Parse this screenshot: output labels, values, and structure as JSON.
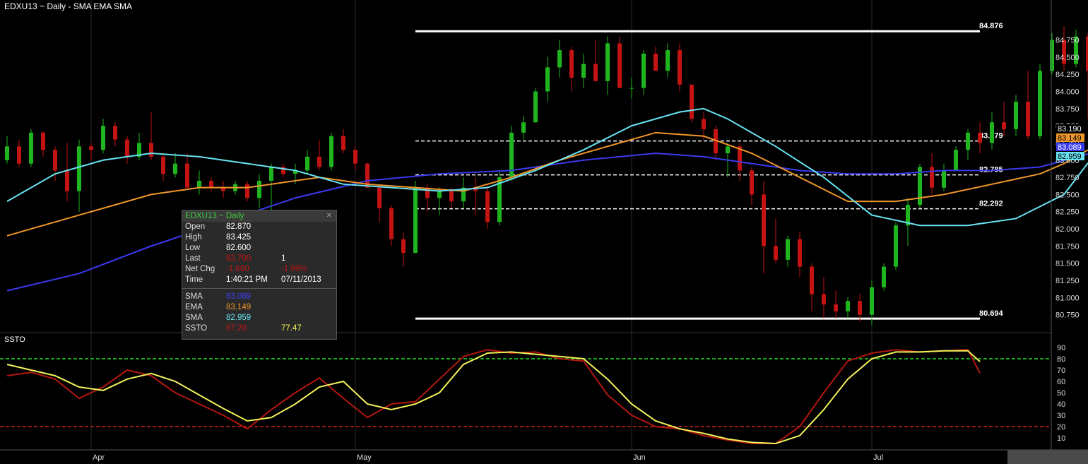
{
  "title": "EDXU13 ~ Daily  -  SMA EMA SMA",
  "ssto_label": "SSTO",
  "colors": {
    "up": "#1fb51f",
    "down": "#c41313",
    "sma_long": "#3a3aef",
    "ema": "#f0962a",
    "sma_short": "#67e3f2",
    "ssto_k": "#b3170f",
    "ssto_d": "#f3f35a",
    "ob": "#24d82c",
    "os": "#d5241f"
  },
  "data_window": {
    "header": "EDXU13 ~ Daily",
    "rows": [
      {
        "label": "Open",
        "v1": "82.870",
        "v2": ""
      },
      {
        "label": "High",
        "v1": "83.425",
        "v2": ""
      },
      {
        "label": "Low",
        "v1": "82.600",
        "v2": ""
      },
      {
        "label": "Last",
        "v1": "82.700",
        "v2": "1"
      },
      {
        "label": "Net Chg",
        "v1": "-1.660",
        "v2": "-1.99%"
      },
      {
        "label": "Time",
        "v1": "1:40:21 PM",
        "v2": "07/11/2013"
      }
    ],
    "ind_rows": [
      {
        "label": "SMA",
        "v1": "83.089",
        "v2": ""
      },
      {
        "label": "EMA",
        "v1": "83.149",
        "v2": ""
      },
      {
        "label": "SMA",
        "v1": "82.959",
        "v2": ""
      },
      {
        "label": "SSTO",
        "v1": "67.20",
        "v2": "77.47"
      }
    ]
  },
  "chart_data": {
    "type": "candlestick",
    "price_axis": {
      "ylim": [
        80.5,
        85.125
      ],
      "ticks": [
        "84.750",
        "84.500",
        "84.250",
        "84.000",
        "83.750",
        "83.500",
        "83.250",
        "83.000",
        "82.750",
        "82.500",
        "82.250",
        "82.000",
        "81.750",
        "81.500",
        "81.250",
        "81.000",
        "80.750"
      ]
    },
    "price_tick_values": [
      84.75,
      84.5,
      84.25,
      84.0,
      83.75,
      83.5,
      83.25,
      83.0,
      82.75,
      82.5,
      82.25,
      82.0,
      81.75,
      81.5,
      81.25,
      81.0,
      80.75
    ],
    "x_labels": [
      {
        "label": "Apr",
        "i": 7
      },
      {
        "label": "May",
        "i": 29
      },
      {
        "label": "Jun",
        "i": 52
      },
      {
        "label": "Jul",
        "i": 72
      }
    ],
    "candles": [
      [
        83.0,
        83.35,
        82.95,
        83.2
      ],
      [
        83.2,
        83.3,
        82.9,
        82.95
      ],
      [
        82.95,
        83.45,
        82.9,
        83.4
      ],
      [
        83.4,
        83.42,
        83.05,
        83.15
      ],
      [
        83.15,
        83.2,
        82.7,
        82.85
      ],
      [
        82.85,
        83.25,
        82.4,
        82.55
      ],
      [
        82.55,
        83.3,
        82.25,
        83.2
      ],
      [
        83.2,
        83.25,
        83.0,
        83.15
      ],
      [
        83.15,
        83.6,
        83.1,
        83.5
      ],
      [
        83.5,
        83.55,
        83.2,
        83.3
      ],
      [
        83.3,
        83.35,
        82.95,
        83.05
      ],
      [
        83.05,
        83.4,
        83.0,
        83.25
      ],
      [
        83.25,
        83.7,
        83.0,
        83.05
      ],
      [
        83.05,
        83.1,
        82.7,
        82.8
      ],
      [
        82.8,
        83.1,
        82.75,
        82.95
      ],
      [
        82.95,
        83.1,
        82.6,
        82.6
      ],
      [
        82.6,
        82.85,
        82.5,
        82.7
      ],
      [
        82.7,
        82.75,
        82.55,
        82.6
      ],
      [
        82.6,
        82.7,
        82.45,
        82.55
      ],
      [
        82.55,
        82.7,
        82.5,
        82.65
      ],
      [
        82.65,
        82.7,
        82.4,
        82.45
      ],
      [
        82.45,
        82.8,
        82.3,
        82.7
      ],
      [
        82.7,
        82.95,
        82.25,
        82.9
      ],
      [
        82.9,
        82.95,
        82.75,
        82.8
      ],
      [
        82.8,
        82.95,
        82.65,
        82.85
      ],
      [
        82.85,
        83.15,
        82.8,
        83.05
      ],
      [
        83.05,
        83.3,
        82.85,
        82.9
      ],
      [
        82.9,
        83.4,
        82.85,
        83.35
      ],
      [
        83.35,
        83.45,
        83.1,
        83.15
      ],
      [
        83.15,
        83.2,
        82.85,
        82.95
      ],
      [
        82.95,
        82.96,
        82.6,
        82.6
      ],
      [
        82.6,
        82.65,
        82.1,
        82.3
      ],
      [
        82.3,
        82.35,
        81.75,
        81.85
      ],
      [
        81.85,
        81.95,
        81.45,
        81.65
      ],
      [
        81.65,
        82.7,
        81.75,
        82.6
      ],
      [
        82.6,
        82.65,
        82.25,
        82.45
      ],
      [
        82.45,
        82.6,
        82.2,
        82.55
      ],
      [
        82.55,
        82.6,
        82.3,
        82.4
      ],
      [
        82.4,
        82.75,
        82.3,
        82.6
      ],
      [
        82.6,
        82.75,
        82.2,
        82.55
      ],
      [
        82.55,
        82.65,
        82.0,
        82.1
      ],
      [
        82.1,
        82.85,
        82.05,
        82.75
      ],
      [
        82.75,
        83.5,
        82.7,
        83.4
      ],
      [
        83.4,
        83.65,
        83.3,
        83.55
      ],
      [
        83.55,
        84.05,
        83.55,
        84.0
      ],
      [
        84.0,
        84.5,
        83.85,
        84.35
      ],
      [
        84.35,
        84.75,
        84.2,
        84.6
      ],
      [
        84.6,
        84.65,
        84.0,
        84.2
      ],
      [
        84.2,
        84.55,
        84.05,
        84.4
      ],
      [
        84.4,
        84.75,
        84.15,
        84.15
      ],
      [
        84.15,
        84.8,
        83.95,
        84.7
      ],
      [
        84.7,
        84.8,
        84.05,
        84.05
      ],
      [
        84.05,
        84.2,
        83.9,
        84.05
      ],
      [
        84.05,
        84.6,
        83.95,
        84.55
      ],
      [
        84.55,
        84.65,
        84.3,
        84.3
      ],
      [
        84.3,
        84.7,
        84.2,
        84.6
      ],
      [
        84.6,
        84.7,
        84.0,
        84.1
      ],
      [
        84.1,
        84.0,
        83.55,
        83.6
      ],
      [
        83.6,
        83.7,
        83.3,
        83.45
      ],
      [
        83.45,
        83.5,
        83.0,
        83.1
      ],
      [
        83.1,
        83.25,
        82.75,
        83.2
      ],
      [
        83.2,
        83.25,
        82.7,
        82.85
      ],
      [
        82.85,
        82.9,
        82.35,
        82.5
      ],
      [
        82.5,
        82.7,
        81.35,
        81.75
      ],
      [
        81.75,
        82.15,
        81.5,
        81.55
      ],
      [
        81.55,
        81.9,
        81.45,
        81.85
      ],
      [
        81.85,
        81.95,
        81.3,
        81.45
      ],
      [
        81.45,
        81.5,
        80.8,
        81.05
      ],
      [
        81.05,
        81.3,
        80.7,
        80.9
      ],
      [
        80.9,
        81.1,
        80.7,
        80.8
      ],
      [
        80.8,
        81.0,
        80.7,
        80.95
      ],
      [
        80.95,
        81.05,
        80.65,
        80.75
      ],
      [
        80.75,
        81.25,
        80.6,
        81.15
      ],
      [
        81.15,
        81.5,
        81.1,
        81.45
      ],
      [
        81.45,
        82.1,
        81.4,
        82.05
      ],
      [
        82.05,
        82.45,
        81.75,
        82.35
      ],
      [
        82.35,
        82.95,
        82.3,
        82.9
      ],
      [
        82.9,
        83.1,
        82.5,
        82.6
      ],
      [
        82.6,
        82.95,
        82.55,
        82.85
      ],
      [
        82.85,
        83.2,
        82.85,
        83.15
      ],
      [
        83.15,
        83.45,
        83.0,
        83.4
      ],
      [
        83.4,
        83.55,
        83.1,
        83.25
      ],
      [
        83.25,
        83.7,
        83.15,
        83.55
      ],
      [
        83.55,
        83.85,
        83.35,
        83.45
      ],
      [
        83.45,
        83.95,
        83.35,
        83.85
      ],
      [
        83.85,
        84.3,
        83.3,
        83.35
      ],
      [
        83.35,
        84.4,
        83.3,
        84.3
      ],
      [
        84.3,
        84.85,
        84.25,
        84.75
      ],
      [
        84.75,
        84.95,
        84.3,
        84.4
      ],
      [
        84.4,
        84.9,
        84.35,
        84.8
      ],
      [
        84.8,
        84.85,
        83.6,
        84.3
      ],
      [
        82.87,
        83.425,
        82.6,
        82.7
      ]
    ],
    "series": [
      {
        "name": "SMA",
        "color": "#3a3aef",
        "points": [
          [
            0,
            81.1
          ],
          [
            6,
            81.35
          ],
          [
            12,
            81.75
          ],
          [
            18,
            82.1
          ],
          [
            24,
            82.45
          ],
          [
            30,
            82.7
          ],
          [
            36,
            82.8
          ],
          [
            42,
            82.85
          ],
          [
            48,
            83.0
          ],
          [
            54,
            83.1
          ],
          [
            58,
            83.05
          ],
          [
            62,
            82.95
          ],
          [
            66,
            82.85
          ],
          [
            70,
            82.8
          ],
          [
            74,
            82.8
          ],
          [
            78,
            82.85
          ],
          [
            82,
            82.85
          ],
          [
            86,
            82.9
          ],
          [
            90,
            83.09
          ]
        ]
      },
      {
        "name": "EMA",
        "color": "#f0962a",
        "points": [
          [
            0,
            81.9
          ],
          [
            6,
            82.2
          ],
          [
            12,
            82.5
          ],
          [
            16,
            82.6
          ],
          [
            20,
            82.6
          ],
          [
            26,
            82.75
          ],
          [
            30,
            82.65
          ],
          [
            34,
            82.6
          ],
          [
            38,
            82.55
          ],
          [
            42,
            82.75
          ],
          [
            46,
            83.0
          ],
          [
            50,
            83.2
          ],
          [
            54,
            83.4
          ],
          [
            58,
            83.35
          ],
          [
            62,
            83.1
          ],
          [
            66,
            82.75
          ],
          [
            70,
            82.4
          ],
          [
            74,
            82.4
          ],
          [
            78,
            82.5
          ],
          [
            82,
            82.65
          ],
          [
            86,
            82.8
          ],
          [
            88,
            82.95
          ],
          [
            90,
            83.149
          ]
        ]
      },
      {
        "name": "SMA",
        "color": "#67e3f2",
        "points": [
          [
            0,
            82.4
          ],
          [
            4,
            82.8
          ],
          [
            8,
            83.0
          ],
          [
            12,
            83.1
          ],
          [
            16,
            83.05
          ],
          [
            20,
            82.95
          ],
          [
            24,
            82.85
          ],
          [
            28,
            82.65
          ],
          [
            32,
            82.6
          ],
          [
            36,
            82.55
          ],
          [
            40,
            82.6
          ],
          [
            44,
            82.85
          ],
          [
            48,
            83.15
          ],
          [
            52,
            83.5
          ],
          [
            56,
            83.7
          ],
          [
            58,
            83.75
          ],
          [
            60,
            83.6
          ],
          [
            64,
            83.2
          ],
          [
            68,
            82.75
          ],
          [
            72,
            82.2
          ],
          [
            76,
            82.05
          ],
          [
            80,
            82.05
          ],
          [
            84,
            82.15
          ],
          [
            88,
            82.5
          ],
          [
            90,
            82.959
          ]
        ]
      }
    ],
    "levels": [
      {
        "value": 84.876,
        "label": "84.876",
        "style": "solid"
      },
      {
        "value": 83.279,
        "label": "83.279",
        "style": "dashed"
      },
      {
        "value": 82.785,
        "label": "82.785",
        "style": "dashed"
      },
      {
        "value": 82.292,
        "label": "82.292",
        "style": "dashed"
      },
      {
        "value": 80.694,
        "label": "80.694",
        "style": "solid"
      }
    ],
    "level_span_i": [
      34,
      81
    ],
    "price_tags": [
      {
        "value": 83.19,
        "label": "83.190",
        "bg": "#000000",
        "fg": "#ffffff"
      },
      {
        "value": 83.149,
        "label": "83.149",
        "bg": "#f0962a",
        "fg": "#000000"
      },
      {
        "value": 83.089,
        "label": "83.089",
        "bg": "#3a3aef",
        "fg": "#ffffff"
      },
      {
        "value": 82.959,
        "label": "82.959",
        "bg": "#67e3f2",
        "fg": "#000000"
      }
    ],
    "ssto": {
      "ylim": [
        0,
        100
      ],
      "ticks": [
        90,
        80,
        70,
        60,
        50,
        40,
        30,
        20,
        10
      ],
      "overbought": 80,
      "oversold": 20,
      "k": [
        [
          0,
          65
        ],
        [
          2,
          68
        ],
        [
          4,
          62
        ],
        [
          6,
          45
        ],
        [
          8,
          55
        ],
        [
          10,
          70
        ],
        [
          12,
          65
        ],
        [
          14,
          50
        ],
        [
          16,
          40
        ],
        [
          18,
          30
        ],
        [
          20,
          18
        ],
        [
          22,
          35
        ],
        [
          24,
          50
        ],
        [
          26,
          63
        ],
        [
          28,
          45
        ],
        [
          30,
          28
        ],
        [
          32,
          40
        ],
        [
          34,
          42
        ],
        [
          36,
          62
        ],
        [
          38,
          82
        ],
        [
          40,
          88
        ],
        [
          42,
          85
        ],
        [
          44,
          86
        ],
        [
          46,
          80
        ],
        [
          48,
          78
        ],
        [
          50,
          48
        ],
        [
          52,
          30
        ],
        [
          54,
          20
        ],
        [
          56,
          18
        ],
        [
          58,
          12
        ],
        [
          60,
          8
        ],
        [
          62,
          5
        ],
        [
          64,
          5
        ],
        [
          66,
          20
        ],
        [
          68,
          50
        ],
        [
          70,
          78
        ],
        [
          72,
          85
        ],
        [
          74,
          88
        ],
        [
          76,
          86
        ],
        [
          78,
          87
        ],
        [
          80,
          88
        ],
        [
          81,
          67.2
        ]
      ],
      "d": [
        [
          0,
          75
        ],
        [
          2,
          70
        ],
        [
          4,
          65
        ],
        [
          6,
          55
        ],
        [
          8,
          52
        ],
        [
          10,
          62
        ],
        [
          12,
          67
        ],
        [
          14,
          60
        ],
        [
          16,
          48
        ],
        [
          18,
          36
        ],
        [
          20,
          25
        ],
        [
          22,
          28
        ],
        [
          24,
          40
        ],
        [
          26,
          55
        ],
        [
          28,
          60
        ],
        [
          30,
          40
        ],
        [
          32,
          35
        ],
        [
          34,
          40
        ],
        [
          36,
          50
        ],
        [
          38,
          75
        ],
        [
          40,
          85
        ],
        [
          42,
          86
        ],
        [
          44,
          84
        ],
        [
          46,
          82
        ],
        [
          48,
          80
        ],
        [
          50,
          62
        ],
        [
          52,
          40
        ],
        [
          54,
          25
        ],
        [
          56,
          18
        ],
        [
          58,
          14
        ],
        [
          60,
          9
        ],
        [
          62,
          6
        ],
        [
          64,
          5
        ],
        [
          66,
          12
        ],
        [
          68,
          35
        ],
        [
          70,
          62
        ],
        [
          72,
          80
        ],
        [
          74,
          86
        ],
        [
          76,
          86
        ],
        [
          78,
          87
        ],
        [
          80,
          87
        ],
        [
          81,
          77.47
        ]
      ]
    }
  }
}
